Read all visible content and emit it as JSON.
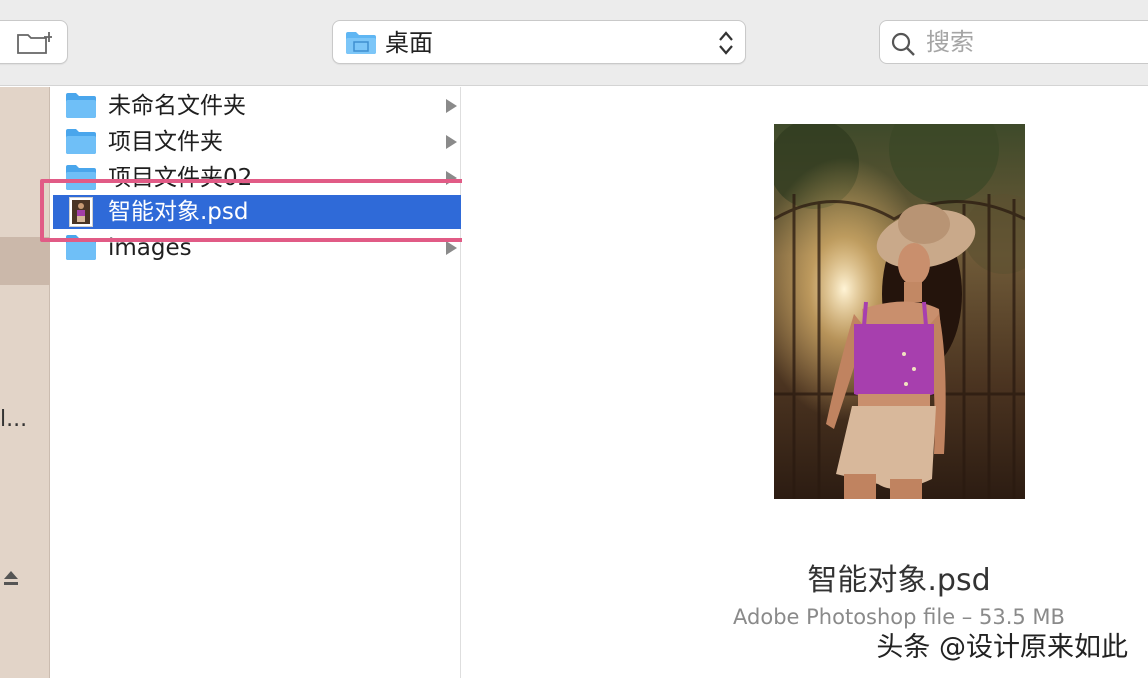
{
  "toolbar": {
    "new_folder_icon": "new-folder-icon",
    "location": {
      "label": "桌面",
      "icon": "folder-icon"
    },
    "search": {
      "placeholder": "搜索"
    }
  },
  "sidebar": {
    "truncated_item": "l..."
  },
  "files": [
    {
      "name": "未命名文件夹",
      "type": "folder",
      "has_children": true
    },
    {
      "name": "项目文件夹",
      "type": "folder",
      "has_children": true
    },
    {
      "name": "项目文件夹02",
      "type": "folder",
      "has_children": true
    },
    {
      "name": "智能对象.psd",
      "type": "psd",
      "selected": true
    },
    {
      "name": "images",
      "type": "folder",
      "has_children": true
    }
  ],
  "preview": {
    "filename": "智能对象.psd",
    "info": "Adobe Photoshop file – 53.5 MB"
  },
  "watermark": "头条 @设计原来如此",
  "colors": {
    "selection": "#2f6ad8",
    "highlight_border": "#e15b86",
    "folder_blue": "#5fb6f3"
  }
}
